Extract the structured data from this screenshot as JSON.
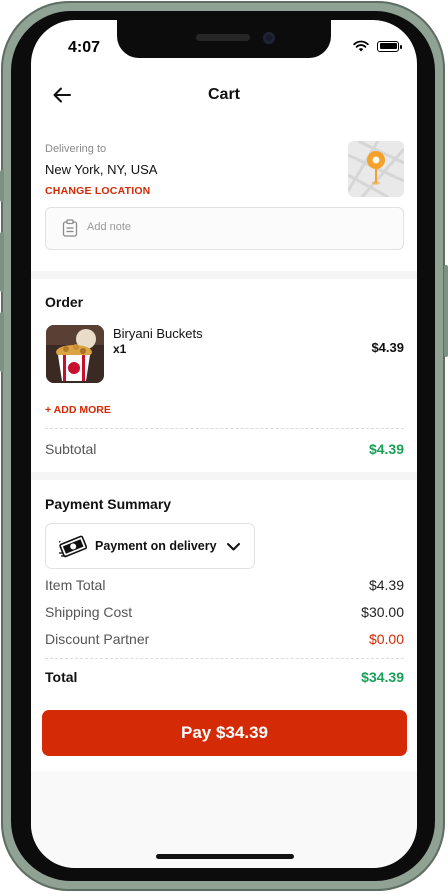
{
  "status_bar": {
    "time": "4:07"
  },
  "header": {
    "title": "Cart",
    "back_icon": "arrow-left-icon"
  },
  "delivery": {
    "label": "Delivering to",
    "location": "New York, NY, USA",
    "change_location": "CHANGE LOCATION",
    "map_pin_color": "#f4a22b"
  },
  "note": {
    "placeholder": "Add note",
    "icon": "clipboard-icon"
  },
  "order": {
    "title": "Order",
    "items": [
      {
        "name": "Biryani Buckets",
        "qty": "x1",
        "price": "$4.39"
      }
    ],
    "add_more": "+ ADD MORE",
    "subtotal_label": "Subtotal",
    "subtotal_value": "$4.39"
  },
  "payment": {
    "title": "Payment Summary",
    "method": "Payment on delivery",
    "method_icon": "cash-icon",
    "rows": [
      {
        "label": "Item Total",
        "value": "$4.39"
      },
      {
        "label": "Shipping Cost",
        "value": "$30.00"
      },
      {
        "label": "Discount Partner",
        "value": "$0.00"
      }
    ],
    "total_label": "Total",
    "total_value": "$34.39"
  },
  "pay_button": {
    "label": "Pay $34.39"
  },
  "colors": {
    "accent": "#d42a06",
    "success": "#18a058"
  }
}
